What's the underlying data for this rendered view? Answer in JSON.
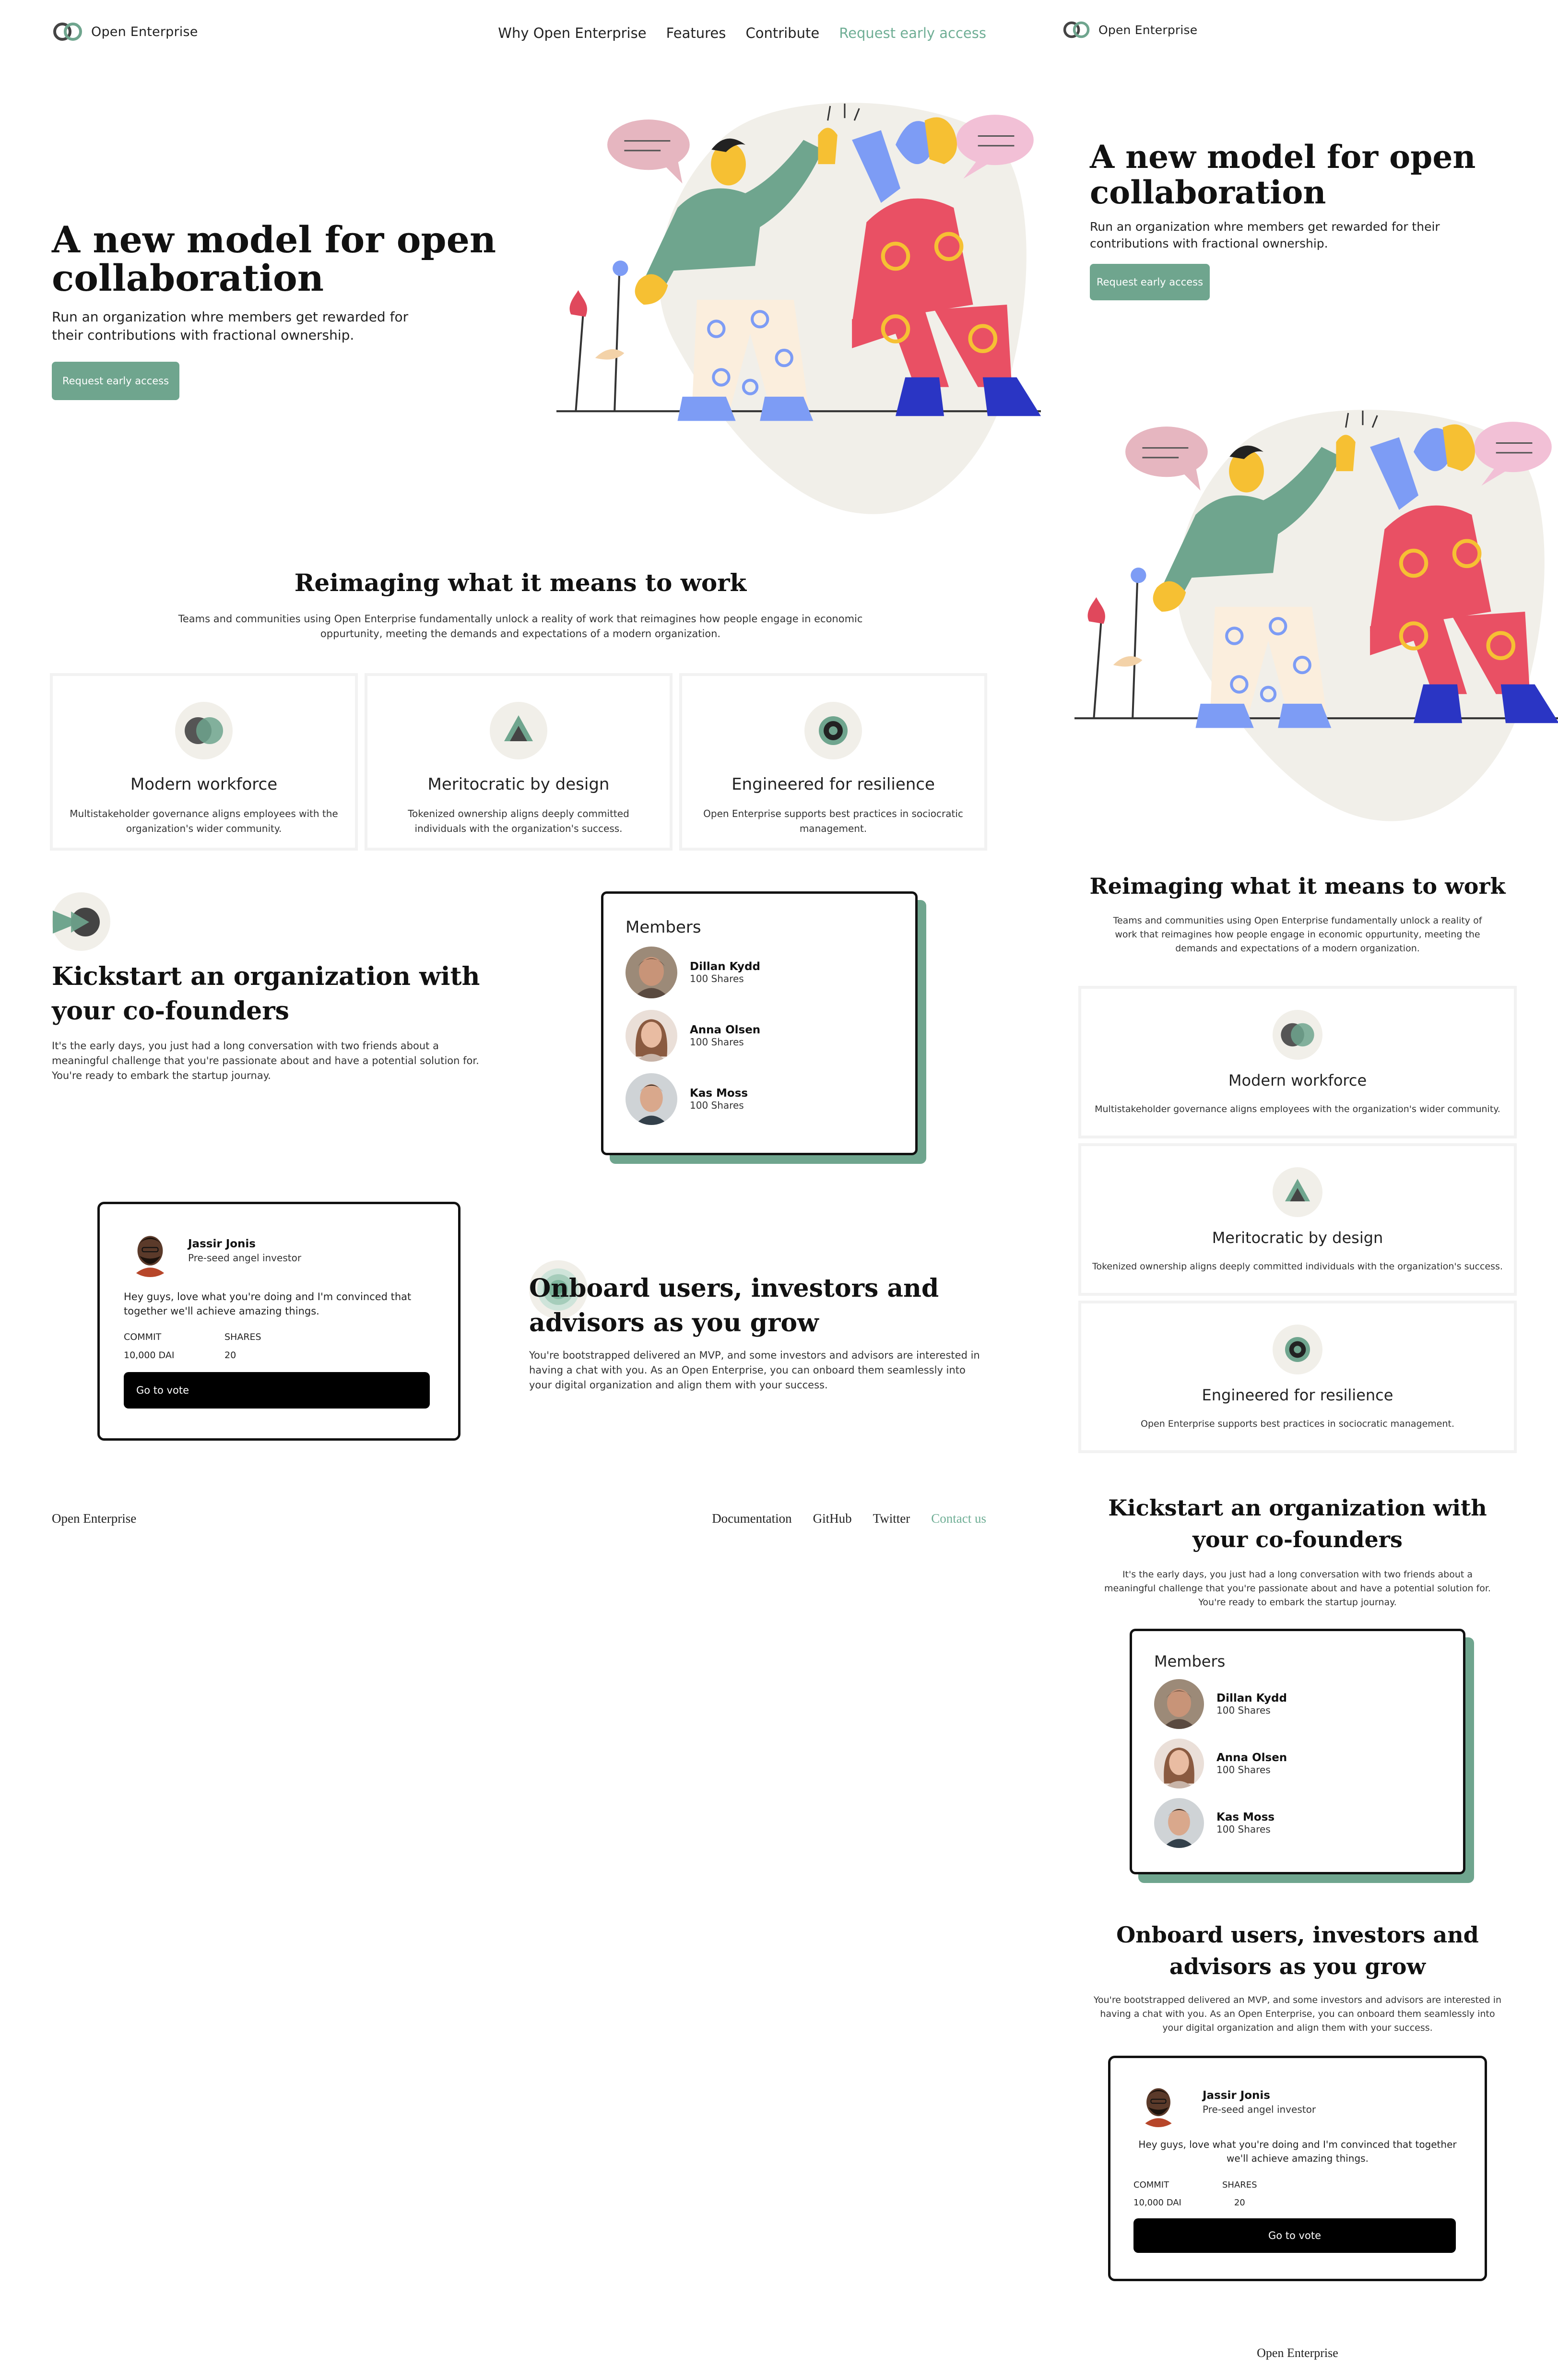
{
  "brand": {
    "name": "Open Enterprise"
  },
  "nav": {
    "items": [
      {
        "label": "Why Open  Enterprise"
      },
      {
        "label": "Features"
      },
      {
        "label": "Contribute"
      },
      {
        "label": "Request early access"
      }
    ]
  },
  "hero": {
    "title_line1": "A new model for open",
    "title_line2": "collaboration",
    "subtitle": "Run an organization whre members get rewarded for their contributions with fractional ownership.",
    "cta": "Request early access"
  },
  "reimagine": {
    "title": "Reimaging what it means to work",
    "description": "Teams and communities using Open  Enterprise fundamentally unlock a reality of work that reimagines how people engage in economic oppurtunity, meeting the demands and expectations of a modern organization.",
    "cards": [
      {
        "title": "Modern workforce",
        "text": "Multistakeholder governance aligns employees with the organization's wider community."
      },
      {
        "title": "Meritocratic by design",
        "text": "Tokenized ownership aligns deeply committed individuals with the organization's success."
      },
      {
        "title": "Engineered for resilience",
        "text": "Open  Enterprise supports best practices in sociocratic management."
      }
    ]
  },
  "kickstart": {
    "title": "Kickstart an organization with your co-founders",
    "text": "It's the early days, you just had a long conversation with two friends about a meaningful challenge that you're passionate about and have a potential solution for. You're ready to embark the startup journay."
  },
  "members": {
    "title": "Members",
    "list": [
      {
        "name": "Dillan Kydd",
        "shares": "100 Shares"
      },
      {
        "name": "Anna Olsen",
        "shares": "100 Shares"
      },
      {
        "name": "Kas Moss",
        "shares": "100 Shares"
      }
    ]
  },
  "onboard": {
    "title": "Onboard users, investors and advisors as you grow",
    "text": "You're bootstrapped delivered an  MVP, and some investors and advisors are interested in having a chat with you. As an Open  Enterprise, you can onboard them seamlessly into your digital organization and align them with your success."
  },
  "investor": {
    "name": "Jassir Jonis",
    "role": "Pre-seed angel investor",
    "message": "Hey guys, love what you're doing and  I'm convinced that together we'll achieve amazing things.",
    "commit_label": "COMMIT",
    "commit_value": "10,000  DAI",
    "shares_label": "SHARES",
    "shares_value": "20",
    "button": "Go to vote"
  },
  "footer": {
    "brand": "Open Enterprise",
    "links": [
      {
        "label": "Documentation"
      },
      {
        "label": "GitHub"
      },
      {
        "label": "Twitter"
      },
      {
        "label": "Contact us"
      }
    ]
  },
  "colors": {
    "accent": "#6fa58e",
    "blob": "#f1efe9",
    "text": "#111111"
  }
}
